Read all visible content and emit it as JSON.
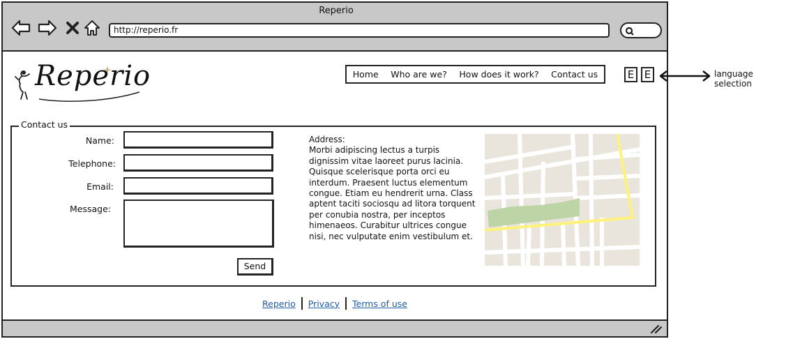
{
  "browser": {
    "title": "Reperio",
    "url": "http://reperio.fr"
  },
  "site": {
    "logo_text": "Reperio"
  },
  "nav": {
    "items": [
      {
        "label": "Home"
      },
      {
        "label": "Who are we?"
      },
      {
        "label": "How does it work?"
      },
      {
        "label": "Contact us"
      }
    ]
  },
  "language": {
    "buttons": [
      "E",
      "E"
    ],
    "annotation": "language selection"
  },
  "contact": {
    "legend": "Contact us",
    "fields": {
      "name": "Name:",
      "telephone": "Telephone:",
      "email": "Email:",
      "message": "Message:"
    },
    "send_label": "Send"
  },
  "address": {
    "heading": "Address:",
    "body": "Morbi adipiscing lectus a turpis dignissim vitae laoreet purus lacinia. Quisque scelerisque porta orci eu interdum. Praesent luctus elementum congue. Etiam eu hendrerit urna. Class aptent taciti sociosqu ad litora torquent per conubia nostra, per inceptos himenaeos. Curabitur ultrices congue nisi, nec vulputate enim vestibulum et."
  },
  "footer": {
    "links": [
      "Reperio",
      "Privacy",
      "Terms of use"
    ]
  },
  "colors": {
    "chrome": "#c8c8c8",
    "link": "#1f5aa6",
    "map_bg": "#e9e5dc",
    "map_road": "#ffffff",
    "map_highway": "#fff27a",
    "map_park": "#bcd4a6"
  }
}
